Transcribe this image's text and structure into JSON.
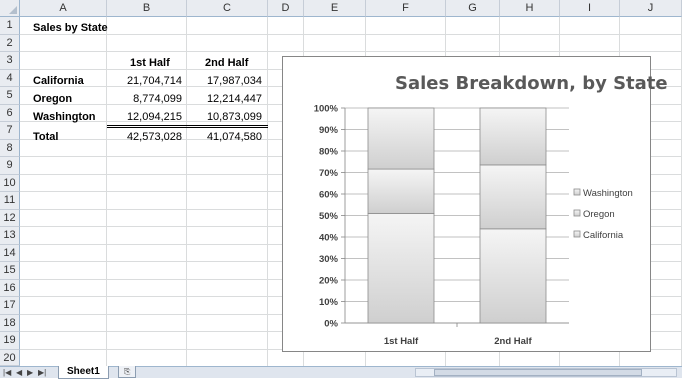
{
  "columns": [
    "A",
    "B",
    "C",
    "D",
    "E",
    "F",
    "G",
    "H",
    "I",
    "J"
  ],
  "rows": [
    "1",
    "2",
    "3",
    "4",
    "5",
    "6",
    "7",
    "8",
    "9",
    "10",
    "11",
    "12",
    "13",
    "14",
    "15",
    "16",
    "17",
    "18",
    "19",
    "20"
  ],
  "cells": {
    "a1": "Sales by State",
    "b3": "1st Half",
    "c3": "2nd Half",
    "a4": "California",
    "b4": "21,704,714",
    "c4": "17,987,034",
    "a5": "Oregon",
    "b5": "8,774,099",
    "c5": "12,214,447",
    "a6": "Washington",
    "b6": "12,094,215",
    "c6": "10,873,099",
    "a7": "Total",
    "b7": "42,573,028",
    "c7": "41,074,580"
  },
  "chart_data": {
    "type": "bar",
    "stacked": "100%",
    "title": "Sales Breakdown, by State",
    "categories": [
      "1st Half",
      "2nd Half"
    ],
    "series": [
      {
        "name": "California",
        "values": [
          21704714,
          17987034
        ]
      },
      {
        "name": "Oregon",
        "values": [
          8774099,
          12214447
        ]
      },
      {
        "name": "Washington",
        "values": [
          12094215,
          10873099
        ]
      }
    ],
    "y_ticks": [
      "0%",
      "10%",
      "20%",
      "30%",
      "40%",
      "50%",
      "60%",
      "70%",
      "80%",
      "90%",
      "100%"
    ],
    "ylim": [
      0,
      100
    ],
    "legend_position": "right",
    "legend": [
      "Washington",
      "Oregon",
      "California"
    ]
  },
  "sheet_tabs": {
    "active": "Sheet1"
  },
  "colors": {
    "header_bg": "#e9ecf1",
    "gridline": "#dadcdd",
    "bar_fill": "#d9d9d9",
    "bar_border": "#8c8c8c"
  }
}
